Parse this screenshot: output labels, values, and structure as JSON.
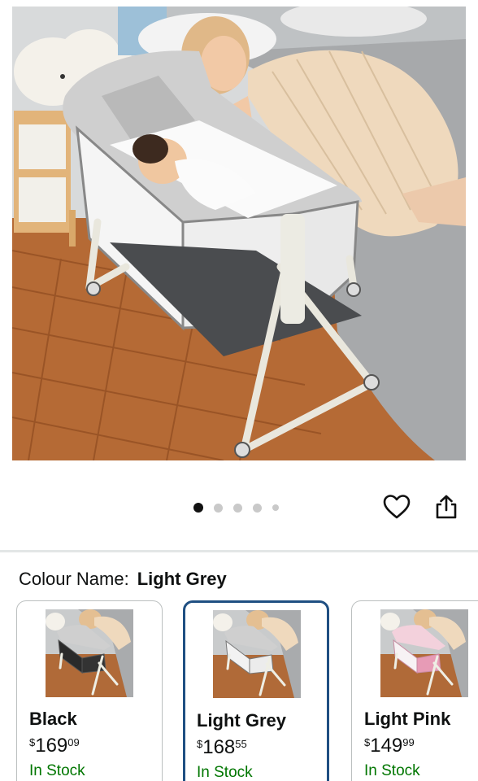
{
  "gallery": {
    "image_subject": "bedside-bassinet-photo",
    "dots_total": 5,
    "active_dot": 1
  },
  "icons": {
    "heart": "heart-icon",
    "share": "share-icon"
  },
  "colour": {
    "label": "Colour Name:",
    "selected": "Light Grey"
  },
  "swatches": [
    {
      "name": "Black",
      "currency": "$",
      "whole": "169",
      "fraction": "09",
      "stock": "In Stock",
      "fabric": "#2a2a2a"
    },
    {
      "name": "Light Grey",
      "currency": "$",
      "whole": "168",
      "fraction": "55",
      "stock": "In Stock",
      "fabric": "#bfbfbf"
    },
    {
      "name": "Light Pink",
      "currency": "$",
      "whole": "149",
      "fraction": "99",
      "stock": "In Stock",
      "fabric": "#e79bb6"
    }
  ],
  "colors": {
    "selected_border": "#1f4f82",
    "in_stock": "#007600",
    "text": "#0f1111"
  }
}
